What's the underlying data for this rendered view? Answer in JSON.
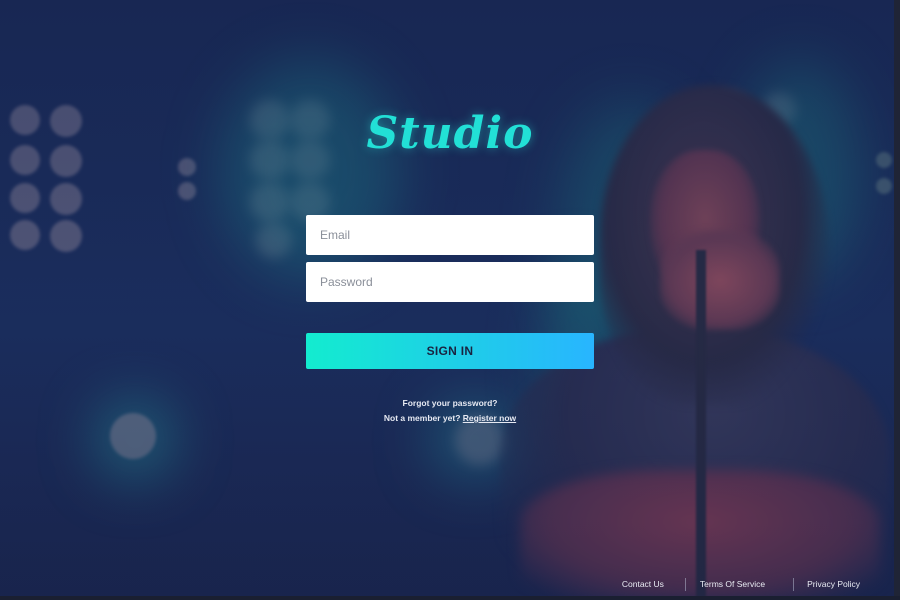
{
  "brand": {
    "logo_text": "Studio",
    "accent_color": "#22e0d6"
  },
  "login_form": {
    "email_placeholder": "Email",
    "password_placeholder": "Password",
    "submit_label": "SIGN IN",
    "submit_gradient": [
      "#13eccf",
      "#28b5ff"
    ]
  },
  "help_links": {
    "forgot_password": "Forgot your password?",
    "not_member_text": "Not a member yet?",
    "register_link": "Register now"
  },
  "footer": {
    "contact": "Contact Us",
    "terms": "Terms Of Service",
    "privacy": "Privacy Policy"
  }
}
